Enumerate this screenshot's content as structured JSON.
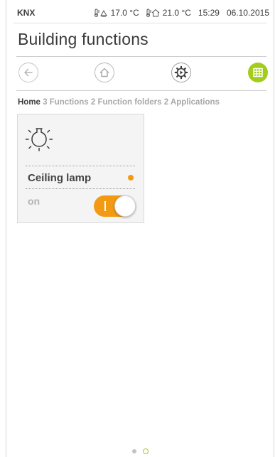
{
  "statusbar": {
    "brand": "KNX",
    "outdoor_temp": "17.0 °C",
    "indoor_temp": "21.0 °C",
    "time": "15:29",
    "date": "06.10.2015"
  },
  "header": {
    "title": "Building functions"
  },
  "nav": {
    "back_icon": "arrow-left-icon",
    "home_icon": "home-icon",
    "settings_icon": "gear-icon",
    "grid_icon": "grid-icon",
    "accent_color": "#a4cc1c"
  },
  "breadcrumb": {
    "home": "Home",
    "rest": " 3 Functions 2 Function folders 2 Applications"
  },
  "card": {
    "icon": "lightbulb-icon",
    "name": "Ceiling lamp",
    "state": "on",
    "status_color": "#f39a14",
    "toggle_on": true
  },
  "pager": {
    "pages": 2,
    "active": 2
  }
}
